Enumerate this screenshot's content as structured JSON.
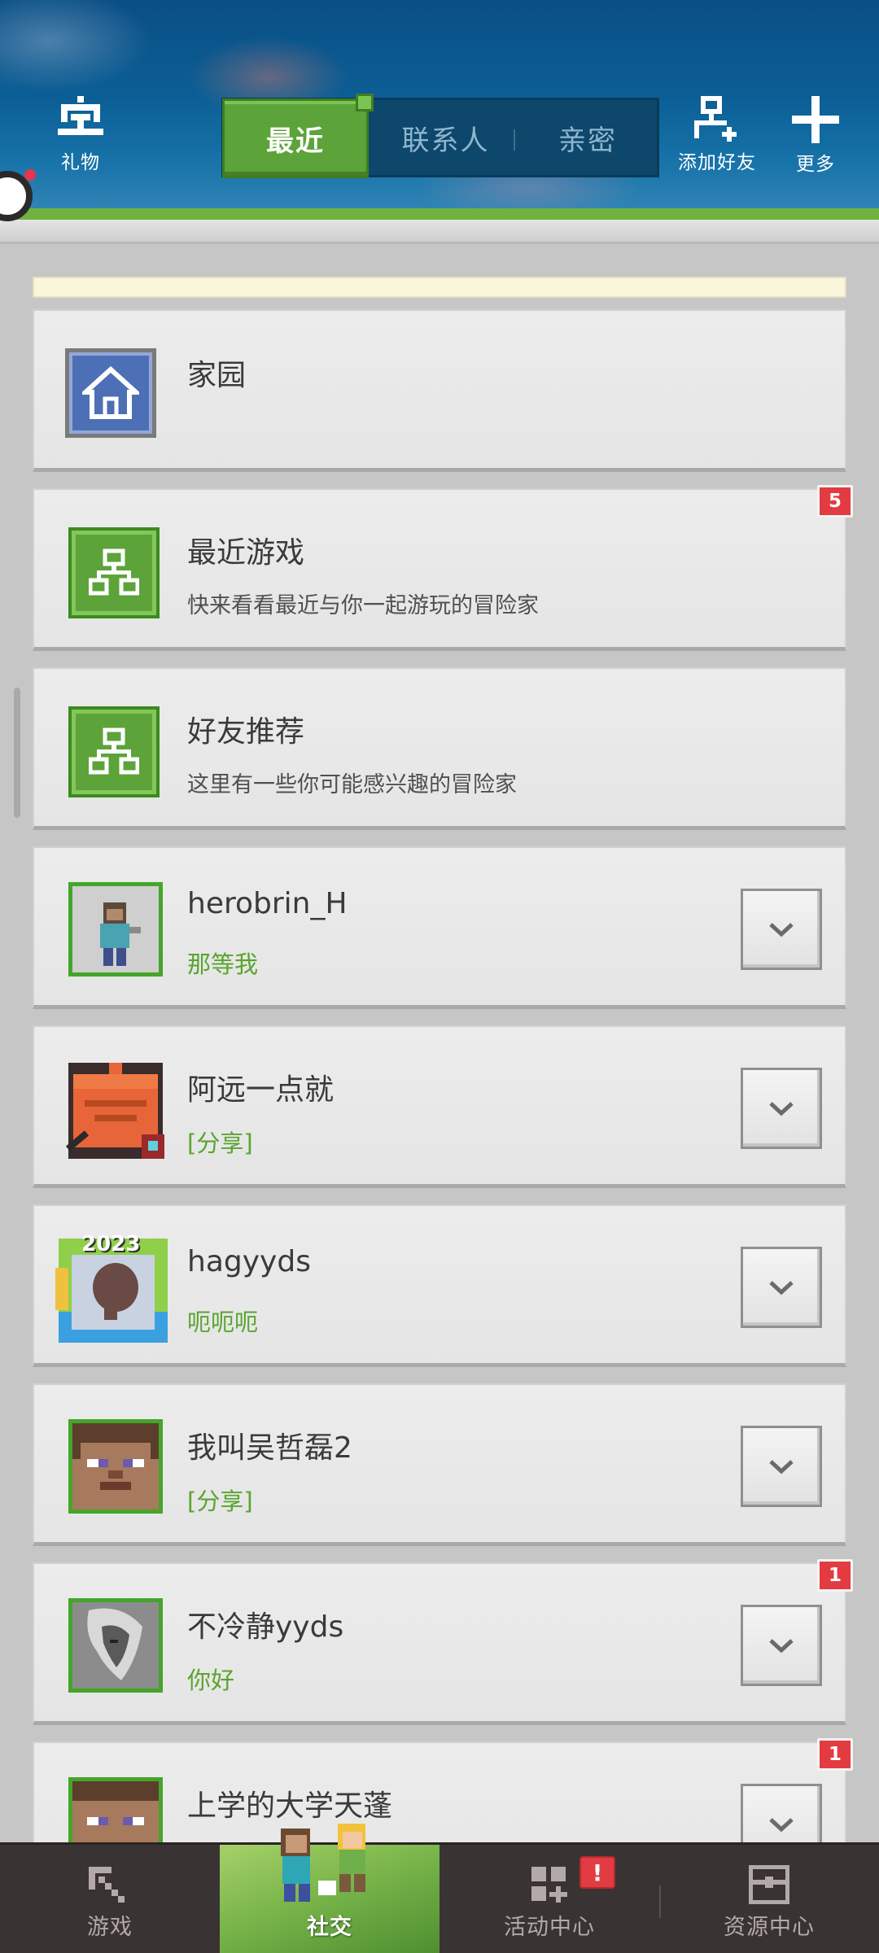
{
  "header": {
    "gift_label": "礼物",
    "tabs": [
      {
        "label": "最近"
      },
      {
        "label": "联系人"
      },
      {
        "label": "亲密"
      }
    ],
    "add_friend_label": "添加好友",
    "more_label": "更多"
  },
  "list": {
    "home": {
      "title": "家园"
    },
    "recent_games": {
      "title": "最近游戏",
      "subtitle": "快来看看最近与你一起游玩的冒险家",
      "badge": "5"
    },
    "friend_recommend": {
      "title": "好友推荐",
      "subtitle": "这里有一些你可能感兴趣的冒险家"
    },
    "friends": [
      {
        "name": "herobrin_H",
        "message": "那等我"
      },
      {
        "name": "阿远一点就",
        "message": "[分享]"
      },
      {
        "name": "hagyyds",
        "message": "呃呃呃",
        "frame_text": "2023"
      },
      {
        "name": "我叫吴哲磊2",
        "message": "[分享]"
      },
      {
        "name": "不冷静yyds",
        "message": "你好",
        "badge": "1"
      },
      {
        "name": "上学的大学天蓬",
        "message": "",
        "badge": "1"
      }
    ]
  },
  "bottom_nav": {
    "items": [
      {
        "label": "游戏"
      },
      {
        "label": "社交"
      },
      {
        "label": "活动中心",
        "badge": "!"
      },
      {
        "label": "资源中心"
      }
    ]
  },
  "colors": {
    "accent_green": "#5ca33a",
    "message_green": "#5aa42f",
    "badge_red": "#e23b41",
    "header_blue": "#0b5e95"
  }
}
